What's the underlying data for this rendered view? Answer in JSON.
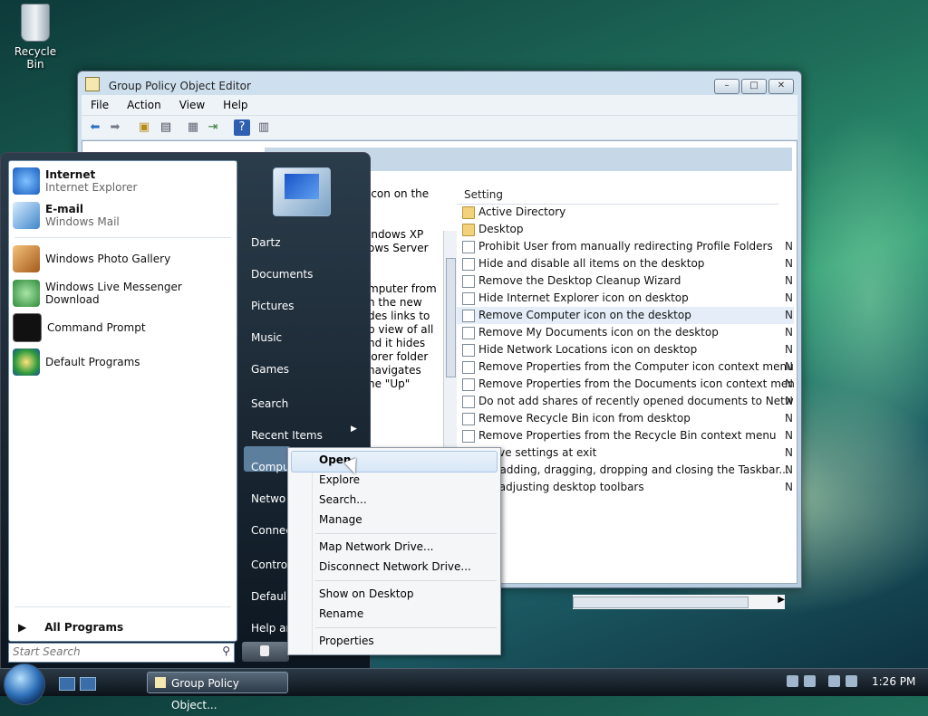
{
  "desktop": {
    "recycle_bin": "Recycle Bin"
  },
  "window": {
    "title": "Group Policy Object Editor",
    "menus": [
      "File",
      "Action",
      "View",
      "Help"
    ],
    "description_lines": [
      "icon on the",
      "",
      "",
      "indows XP",
      "ows Server",
      "",
      "",
      "mputer from",
      "n the new",
      "des links to",
      "b view of all",
      "nd it hides",
      "lorer folder",
      "navigates",
      "ne \"Up\""
    ],
    "settings_header": "Setting",
    "settings": [
      {
        "label": "Active Directory",
        "type": "folder",
        "state": ""
      },
      {
        "label": "Desktop",
        "type": "folder",
        "state": ""
      },
      {
        "label": "Prohibit User from manually redirecting Profile Folders",
        "type": "policy",
        "state": "N"
      },
      {
        "label": "Hide and disable all items on the desktop",
        "type": "policy",
        "state": "N"
      },
      {
        "label": "Remove the Desktop Cleanup Wizard",
        "type": "policy",
        "state": "N"
      },
      {
        "label": "Hide Internet Explorer icon on desktop",
        "type": "policy",
        "state": "N"
      },
      {
        "label": "Remove Computer icon on the desktop",
        "type": "policy",
        "state": "N",
        "selected": true
      },
      {
        "label": "Remove My Documents icon on the desktop",
        "type": "policy",
        "state": "N"
      },
      {
        "label": "Hide Network Locations icon on desktop",
        "type": "policy",
        "state": "N"
      },
      {
        "label": "Remove Properties from the Computer icon context menu",
        "type": "policy",
        "state": "N"
      },
      {
        "label": "Remove Properties from the Documents icon context menu",
        "type": "policy",
        "state": "N"
      },
      {
        "label": "Do not add shares of recently opened documents to Networ...",
        "type": "policy",
        "state": "N"
      },
      {
        "label": "Remove Recycle Bin icon from desktop",
        "type": "policy",
        "state": "N"
      },
      {
        "label": "Remove Properties from the Recycle Bin context menu",
        "type": "policy",
        "state": "N"
      },
      {
        "label": "t save settings at exit",
        "type": "policy",
        "state": "N"
      },
      {
        "label": "ent adding, dragging, dropping and closing the Taskbar...",
        "type": "policy",
        "state": "N"
      },
      {
        "label": "ibit adjusting desktop toolbars",
        "type": "policy",
        "state": "N"
      }
    ]
  },
  "start_menu": {
    "pinned": [
      {
        "title": "Internet",
        "subtitle": "Internet Explorer",
        "icon": "internet-explorer-icon",
        "color": "#2a7de1"
      },
      {
        "title": "E-mail",
        "subtitle": "Windows Mail",
        "icon": "windows-mail-icon",
        "color": "#3f86c9"
      }
    ],
    "recent": [
      {
        "title": "Windows Photo Gallery",
        "icon": "photo-gallery-icon",
        "color": "#d88a2c"
      },
      {
        "title": "Windows Live Messenger Download",
        "icon": "messenger-icon",
        "color": "#3bb04a"
      },
      {
        "title": "Command Prompt",
        "icon": "command-prompt-icon",
        "color": "#111111"
      },
      {
        "title": "Default Programs",
        "icon": "default-programs-icon",
        "color": "#2e9b3c"
      }
    ],
    "all_programs": "All Programs",
    "search_placeholder": "Start Search",
    "right_links": [
      "Dartz",
      "Documents",
      "Pictures",
      "Music",
      "Games",
      "Search",
      "Recent Items",
      "Compu",
      "Netwo",
      "Connec",
      "Control",
      "Defaul",
      "Help an"
    ]
  },
  "context_menu": {
    "items": [
      {
        "label": "Open",
        "bold": true
      },
      {
        "label": "Explore"
      },
      {
        "label": "Search..."
      },
      {
        "label": "Manage"
      },
      {
        "label": "Map Network Drive..."
      },
      {
        "label": "Disconnect Network Drive..."
      },
      {
        "label": "Show on Desktop"
      },
      {
        "label": "Rename"
      },
      {
        "label": "Properties"
      }
    ]
  },
  "taskbar": {
    "task_button": "Group Policy Object...",
    "clock": "1:26 PM"
  }
}
